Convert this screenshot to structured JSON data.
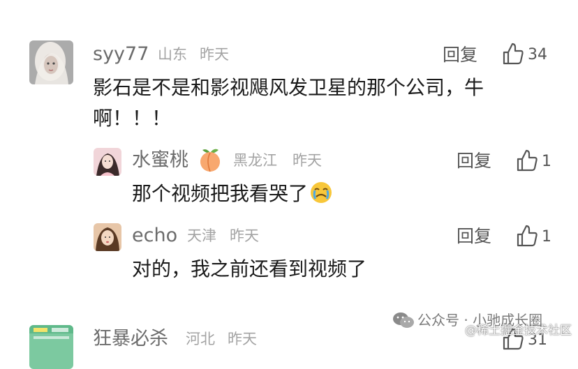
{
  "comments": [
    {
      "username": "syy77",
      "location": "山东",
      "time": "昨天",
      "content_line1": "影石是不是和影视飓风发卫星的那个公司，牛",
      "content_line2": "啊！！！",
      "reply_label": "回复",
      "likes": "34"
    },
    {
      "username": "水蜜桃",
      "location": "黑龙江",
      "time": "昨天",
      "content": "那个视频把我看哭了",
      "reply_label": "回复",
      "likes": "1"
    },
    {
      "username": "echo",
      "location": "天津",
      "time": "昨天",
      "content": "对的，我之前还看到视频了",
      "reply_label": "回复",
      "likes": "1"
    },
    {
      "username": "狂暴必杀",
      "location": "河北",
      "time": "昨天",
      "likes": "31"
    }
  ],
  "watermark": {
    "account": "公众号 · 小驰成长圈",
    "site": "@稀土掘金技术社区"
  }
}
